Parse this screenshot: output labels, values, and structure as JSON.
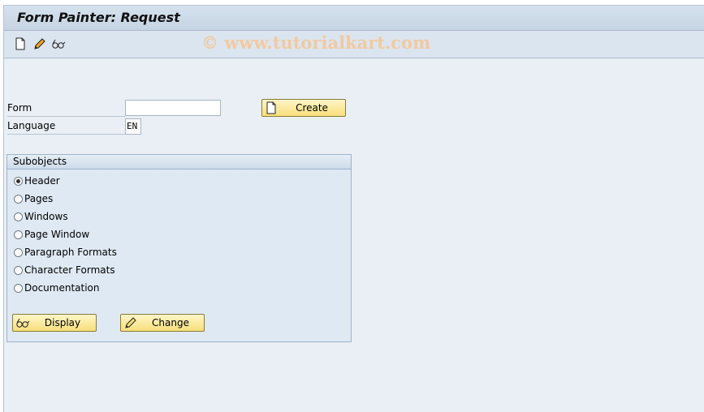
{
  "title": "Form Painter: Request",
  "watermark": "© www.tutorialkart.com",
  "toolbar": {
    "icons": [
      "new-document-icon",
      "pencil-icon",
      "glasses-icon"
    ]
  },
  "form": {
    "form_label": "Form",
    "form_value": "",
    "language_label": "Language",
    "language_value": "EN",
    "create_label": "Create"
  },
  "subobjects": {
    "title": "Subobjects",
    "options": [
      {
        "label": "Header",
        "selected": true
      },
      {
        "label": "Pages",
        "selected": false
      },
      {
        "label": "Windows",
        "selected": false
      },
      {
        "label": "Page Window",
        "selected": false
      },
      {
        "label": "Paragraph Formats",
        "selected": false
      },
      {
        "label": "Character Formats",
        "selected": false
      },
      {
        "label": "Documentation",
        "selected": false
      }
    ],
    "display_label": "Display",
    "change_label": "Change"
  },
  "colors": {
    "button": "#f7df7a",
    "background": "#e9eff5",
    "group": "#dfe9f3"
  }
}
